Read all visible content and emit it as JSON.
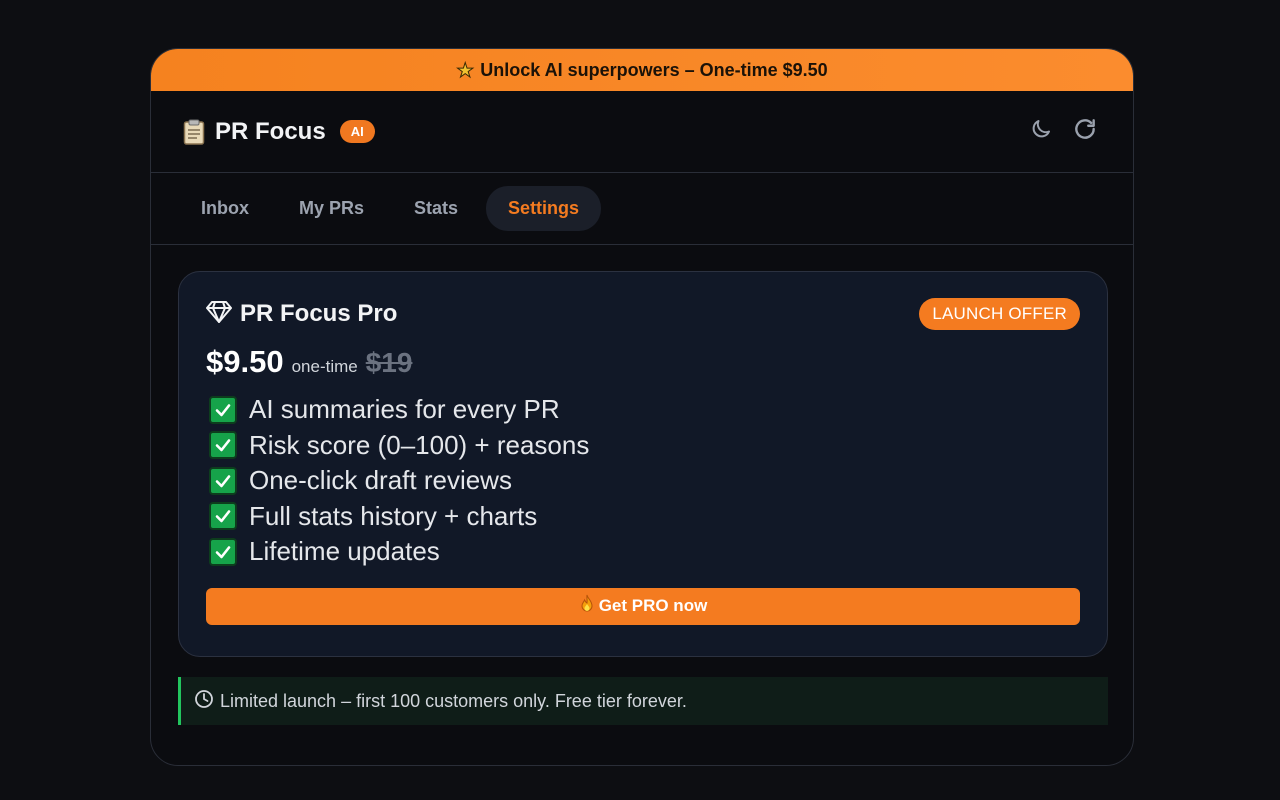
{
  "banner": {
    "icon": "star-icon",
    "text": "Unlock AI superpowers – One-time $9.50"
  },
  "header": {
    "icon": "clipboard-icon",
    "title": "PR Focus",
    "badge": "AI",
    "actions": [
      "moon-icon",
      "refresh-icon"
    ]
  },
  "tabs": [
    {
      "label": "Inbox",
      "active": false
    },
    {
      "label": "My PRs",
      "active": false
    },
    {
      "label": "Stats",
      "active": false
    },
    {
      "label": "Settings",
      "active": true
    }
  ],
  "pro_card": {
    "icon": "diamond-icon",
    "title": "PR Focus Pro",
    "badge": "LAUNCH OFFER",
    "price": "$9.50",
    "price_note": "one-time",
    "old_price": "$19",
    "features": [
      "AI summaries for every PR",
      "Risk score (0–100) + reasons",
      "One-click draft reviews",
      "Full stats history + charts",
      "Lifetime updates"
    ],
    "cta_icon": "fire-icon",
    "cta_label": "Get PRO now"
  },
  "notice": {
    "icon": "clock-icon",
    "text": "Limited launch – first 100 customers only. Free tier forever."
  },
  "colors": {
    "accent": "#f47b20",
    "background": "#0b0c10",
    "card": "#111827",
    "success": "#16a34a",
    "notice_border": "#22c55e"
  }
}
